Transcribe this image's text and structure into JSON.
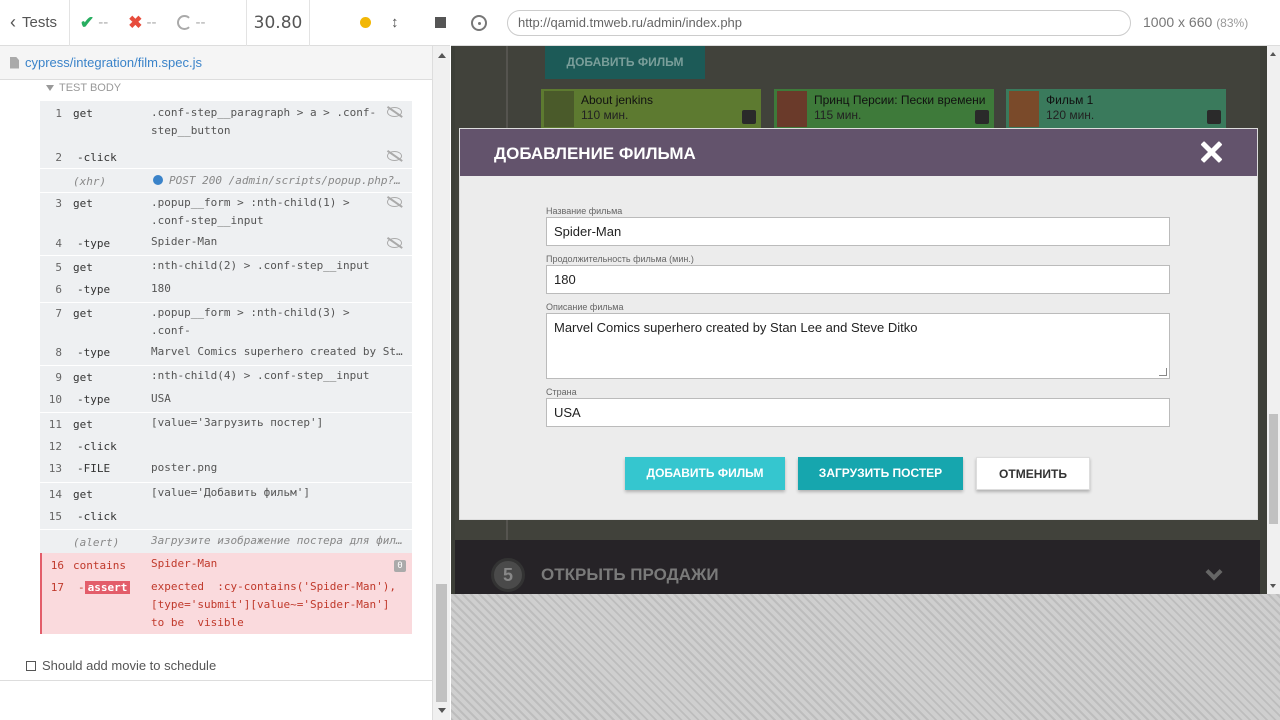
{
  "reporter": {
    "header": {
      "tests_label": "Tests",
      "passed": "--",
      "failed": "--",
      "pending": "--",
      "duration": "30.80"
    },
    "spec_file": "cypress/integration/film.spec.js",
    "section_label": "TEST BODY",
    "commands": [
      {
        "num": "1",
        "name": "get",
        "message": ".conf-step__paragraph > a > .conf-\nstep__button"
      },
      {
        "num": "2",
        "name": "-click",
        "message": ""
      },
      {
        "num": "",
        "name": "(xhr)",
        "message": "POST 200 /admin/scripts/popup.php?..."
      },
      {
        "num": "3",
        "name": "get",
        "message": ".popup__form > :nth-child(1) >\n.conf-step__input"
      },
      {
        "num": "4",
        "name": "-type",
        "message": "Spider-Man"
      },
      {
        "num": "5",
        "name": "get",
        "message": ":nth-child(2) > .conf-step__input"
      },
      {
        "num": "6",
        "name": "-type",
        "message": "180"
      },
      {
        "num": "7",
        "name": "get",
        "message": ".popup__form > :nth-child(3) > .conf-\nstep__input"
      },
      {
        "num": "8",
        "name": "-type",
        "message": "Marvel Comics superhero created by St..."
      },
      {
        "num": "9",
        "name": "get",
        "message": ":nth-child(4) > .conf-step__input"
      },
      {
        "num": "10",
        "name": "-type",
        "message": "USA"
      },
      {
        "num": "11",
        "name": "get",
        "message": "[value='Загрузить постер']"
      },
      {
        "num": "12",
        "name": "-click",
        "message": ""
      },
      {
        "num": "13",
        "name": "-FILE",
        "message": "poster.png"
      },
      {
        "num": "14",
        "name": "get",
        "message": "[value='Добавить фильм']"
      },
      {
        "num": "15",
        "name": "-click",
        "message": ""
      },
      {
        "num": "",
        "name": "(alert)",
        "message": "Загрузите изображение постера для фил..."
      },
      {
        "num": "16",
        "name": "contains",
        "message": "Spider-Man",
        "badge": "0"
      },
      {
        "num": "17",
        "name": "assert",
        "message": "expected  :cy-contains('Spider-Man'),\n[type='submit'][value~='Spider-Man']\nto be  visible"
      }
    ],
    "next_test": "Should add movie to schedule"
  },
  "aut": {
    "url": "http://qamid.tmweb.ru/admin/index.php",
    "viewport": "1000 x 660",
    "scale": "(83%)",
    "page": {
      "add_button": "ДОБАВИТЬ ФИЛЬМ",
      "films": [
        {
          "title": "About jenkins",
          "duration": "110 мин."
        },
        {
          "title": "Принц Персии: Пески времени",
          "duration": "115 мин."
        },
        {
          "title": "Фильм 1",
          "duration": "120 мин."
        }
      ],
      "step5_number": "5",
      "step5_label": "ОТКРЫТЬ ПРОДАЖИ"
    },
    "popup": {
      "title": "ДОБАВЛЕНИЕ ФИЛЬМА",
      "fields": {
        "name_label": "Название фильма",
        "name_value": "Spider-Man",
        "duration_label": "Продолжительность фильма (мин.)",
        "duration_value": "180",
        "description_label": "Описание фильма",
        "description_value": "Marvel Comics superhero created by Stan Lee and Steve Ditko",
        "country_label": "Страна",
        "country_value": "USA"
      },
      "buttons": {
        "add": "ДОБАВИТЬ ФИЛЬМ",
        "upload": "ЗАГРУЗИТЬ ПОСТЕР",
        "cancel": "ОТМЕНИТЬ"
      }
    }
  },
  "colors": {
    "popup_header": "#63536c",
    "accent_cyan": "#35c6cf",
    "accent_teal": "#16a6ae",
    "error_bg": "#fadadd",
    "error_text": "#c0392b"
  }
}
